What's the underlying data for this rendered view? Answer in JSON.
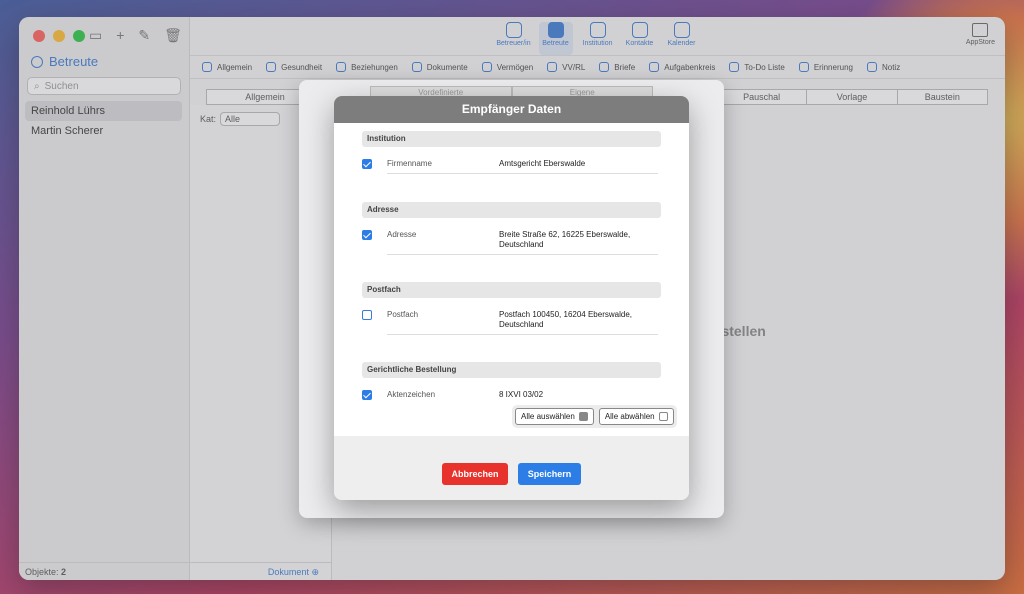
{
  "sidebar": {
    "title": "Betreute",
    "search_placeholder": "Suchen",
    "persons": [
      "Reinhold Lührs",
      "Martin Scherer"
    ],
    "footer_label": "Objekte:",
    "footer_count": "2"
  },
  "toolbar": {
    "tools": [
      {
        "label": "Betreuer/in",
        "icon": "person-group-icon"
      },
      {
        "label": "Betreute",
        "icon": "person-icon"
      },
      {
        "label": "Institution",
        "icon": "building-icon"
      },
      {
        "label": "Kontakte",
        "icon": "at-icon"
      },
      {
        "label": "Kalender",
        "icon": "alarm-clock-icon"
      }
    ],
    "appstore": "AppStore"
  },
  "tabs": [
    "Allgemein",
    "Gesundheit",
    "Beziehungen",
    "Dokumente",
    "Vermögen",
    "VV/RL",
    "Briefe",
    "Aufgabenkreis",
    "To-Do Liste",
    "Erinnerung",
    "Notiz"
  ],
  "subtabs_left": [
    "Allgemein"
  ],
  "subtabs_right": [
    "Pauschal",
    "Vorlage",
    "Baustein"
  ],
  "filter": {
    "label": "Kat:",
    "value": "Alle"
  },
  "list_footer": "Dokument",
  "background_text": "rstellen",
  "panel2": {
    "tabs": [
      "Vordefinierte",
      "Eigene"
    ]
  },
  "dialog": {
    "title": "Empfänger Daten",
    "sections": [
      {
        "title": "Institution",
        "rows": [
          {
            "label": "Firmenname",
            "value": "Amtsgericht Eberswalde",
            "checked": true
          }
        ]
      },
      {
        "title": "Adresse",
        "rows": [
          {
            "label": "Adresse",
            "value": "Breite Straße 62, 16225 Eberswalde, Deutschland",
            "checked": true
          }
        ]
      },
      {
        "title": "Postfach",
        "rows": [
          {
            "label": "Postfach",
            "value": "Postfach 100450, 16204 Eberswalde, Deutschland",
            "checked": false
          }
        ]
      },
      {
        "title": "Gerichtliche Bestellung",
        "rows": [
          {
            "label": "Aktenzeichen",
            "value": "8 IXVI 03/02",
            "checked": true
          }
        ]
      }
    ],
    "select_all": "Alle auswählen",
    "deselect_all": "Alle abwählen",
    "cancel": "Abbrechen",
    "save": "Speichern",
    "colors": {
      "cancel": "#e8322c",
      "save": "#2c7ee6",
      "header": "#7d7d7d"
    }
  }
}
